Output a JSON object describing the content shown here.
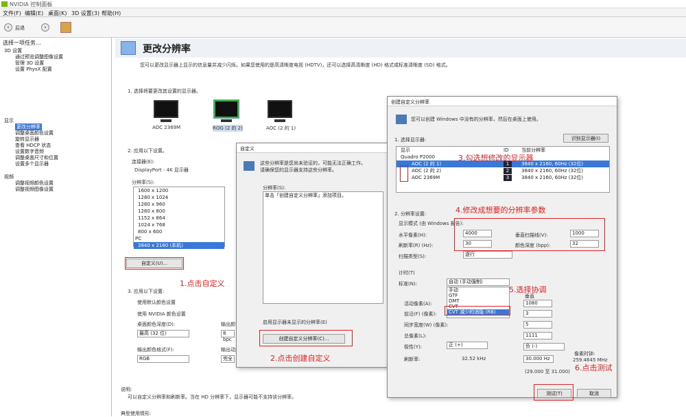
{
  "window": {
    "title": "NVIDIA 控制面板"
  },
  "menu": [
    "文件(F)",
    "编辑(E)",
    "桌面(K)",
    "3D 设置(3)",
    "帮助(H)"
  ],
  "toolbar": {
    "back_label": "后退"
  },
  "sidebar": {
    "heading": "选择一项任务...",
    "items": [
      "3D 设置",
      "通过预览调整图像设置",
      "管理 3D 设置",
      "设置 PhysX 配置",
      "显示",
      "更改分辨率",
      "调整桌面颜色设置",
      "旋转显示器",
      "查看 HDCP 状态",
      "设置数字音频",
      "调整桌面尺寸和位置",
      "设置多个显示器",
      "视频",
      "调整视频颜色设置",
      "调整视频图像设置"
    ]
  },
  "main": {
    "title": "更改分辨率",
    "intro": "您可以更改显示器上显示的信息量并减少闪烁。如果您使用的是高清晰度电视 (HDTV)，还可以选择高清晰度 (HD) 格式或标准清晰度 (SD) 格式。",
    "step1": "1. 选择将要更改其设置的显示器。",
    "monitors": [
      "AOC 2369M",
      "ROG (2 的 2)",
      "AOC (2 的 1)"
    ],
    "step2": "2. 应用以下设置。",
    "connector_label": "连接器(E):",
    "connector_value": "DisplayPort - 4K 显示器",
    "resolution_label": "分辨率(S):",
    "resolutions": [
      "1600 x 1200",
      "1280 x 1024",
      "1280 x 960",
      "1280 x 800",
      "1152 x 864",
      "1024 x 768",
      "800 x 600"
    ],
    "pc_label": "PC",
    "selected_resolution": "3840 x 2160 (本机)",
    "customize_button": "自定义(U)...",
    "step3": "3. 应用以下设置:",
    "radio1": "使用默认颜色设置",
    "radio2": "使用 NVIDIA 颜色设置",
    "desktop_depth_label": "桌面颜色深度(D):",
    "desktop_depth_value": "最高 (32 位)",
    "output_depth_label": "输出颜色深度(O):",
    "output_depth_value": "8 bpc",
    "output_format_label": "输出颜色格式(F):",
    "output_format_value": "RGB",
    "dynamic_range_label": "输出动态范围(R):",
    "dynamic_range_value": "完全",
    "desc_label": "说明:",
    "desc_text": "可以自定义分辨率和刷新率。当在 HD 分辨率下，显示器可能不支持该分辨率。",
    "typical_label": "典型使用情形:"
  },
  "custom_dialog": {
    "title": "自定义",
    "text1": "这些分辨率是您尚未验证的，可能无法正确工作。",
    "text2": "请确保您的显示器支持这些分辨率。",
    "list_label": "分辨率(S):",
    "list_item": "单击「创建自定义分辨率」添加项目。",
    "checkbox_label": "启用显示器未显示的分辨率(E)",
    "create_button": "创建自定义分辨率(C)..."
  },
  "create_dialog": {
    "title": "创建自定义分辨率",
    "info": "您可以创建 Windows 中没有的分辨率，然后在桌面上使用。",
    "step1": "1. 选择显示器:",
    "refresh_button": "识别显示器(I)",
    "col_show": "显示",
    "col_id": "ID",
    "col_res": "当前分辨率",
    "gpu": "Quadro P2000",
    "rows": [
      {
        "name": "AOC (2 的 1)",
        "id": "1",
        "res": "3840 x 2160, 60Hz (32位)"
      },
      {
        "name": "AOC (2 的 2)",
        "id": "2",
        "res": "3840 x 2160, 60Hz (32位)"
      },
      {
        "name": "AOC 2369M",
        "id": "3",
        "res": "3840 x 2160, 60Hz (32位)"
      }
    ],
    "step2": "2. 分辨率设置:",
    "display_mode_label": "显示模式 (由 Windows 报告):",
    "hpixels_label": "水平像素(H):",
    "hpixels_value": "4000",
    "vlines_label": "垂直扫描线(V):",
    "vlines_value": "1000",
    "refresh_label": "刷新率(R) (Hz):",
    "refresh_value": "30",
    "color_depth_label": "颜色深度 (bpp):",
    "color_depth_value": "32",
    "scan_label": "扫描类型(S):",
    "scan_value": "逐行",
    "timing_label": "计时(T)",
    "standard_label": "标准(N):",
    "standard_value": "自动 (手动强制)",
    "options": [
      "手动",
      "GTF",
      "DMT",
      "CVT",
      "CVT 减少的消隐 (RB)"
    ],
    "active_pixels_label": "活动像素(A):",
    "front_porch_label": "前沿(F) (像素):",
    "sync_width_label": "同步宽度(W) (像素):",
    "total_pixels_label": "总像素(L):",
    "polarity_label": "极性(Y):",
    "polarity_value": "正 (+)",
    "refresh_rate_label": "刷新率:",
    "refresh_rate_value": "32.52 kHz",
    "vertical_label": "垂直",
    "v_values": [
      "1080",
      "3",
      "5",
      "1111"
    ],
    "v_polarity": "负 (-)",
    "v_refresh": "30.000 Hz",
    "pixel_clock_label": "像素时钟:",
    "pixel_clock_value": "259.4645 MHz",
    "range_value": "(29.000 至 31.000)",
    "test_button": "测试(T)",
    "cancel_button": "取消"
  },
  "annotations": {
    "a1": "1.点击自定义",
    "a2": "2.点击创建自定义",
    "a3": "3.勾选想修改的显示器",
    "a4": "4.修改成想要的分辨率参数",
    "a5": "5.选择协调",
    "a6": "6.点击测试",
    "color": "#e02020"
  }
}
